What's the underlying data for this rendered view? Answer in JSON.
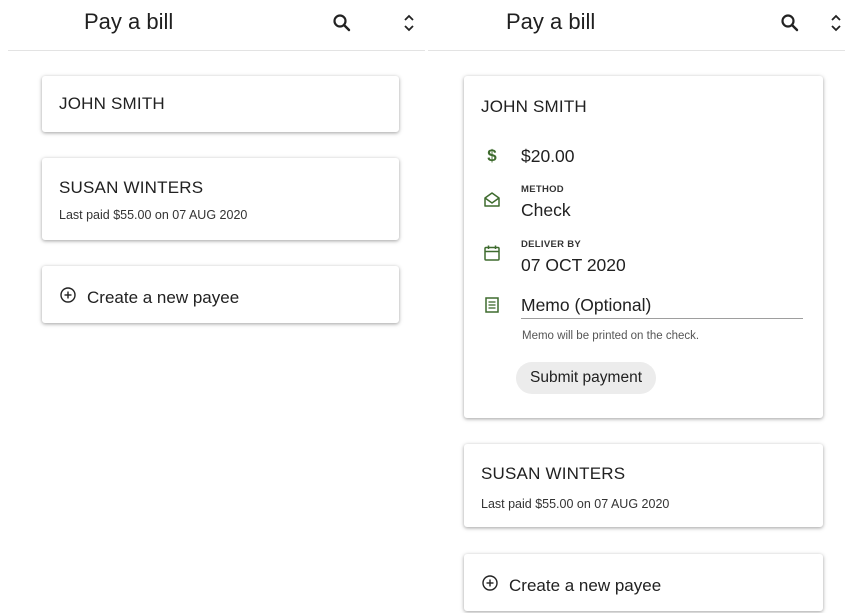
{
  "colors": {
    "accent": "#3e6b2e",
    "divider": "#e3e3e3"
  },
  "left": {
    "header": {
      "title": "Pay a bill",
      "search_icon": "search-icon",
      "sort_icon": "unfold-more-icon"
    },
    "payees": [
      {
        "name": "JOHN SMITH"
      },
      {
        "name": "SUSAN WINTERS",
        "last_paid": "Last paid $55.00 on 07 AUG 2020"
      }
    ],
    "create": {
      "icon": "add-circle-outline-icon",
      "label": "Create a new payee"
    }
  },
  "right": {
    "header": {
      "title": "Pay a bill",
      "search_icon": "search-icon",
      "sort_icon": "unfold-more-icon"
    },
    "expanded": {
      "name": "JOHN SMITH",
      "amount": "$20.00",
      "method_label": "METHOD",
      "method_value": "Check",
      "deliver_label": "DELIVER BY",
      "deliver_value": "07 OCT 2020",
      "memo_placeholder": "Memo (Optional)",
      "memo_help": "Memo will be printed on the check.",
      "submit_label": "Submit payment"
    },
    "payees": [
      {
        "name": "SUSAN WINTERS",
        "last_paid": "Last paid $55.00 on 07 AUG 2020"
      }
    ],
    "create": {
      "icon": "add-circle-outline-icon",
      "label": "Create a new payee"
    }
  }
}
